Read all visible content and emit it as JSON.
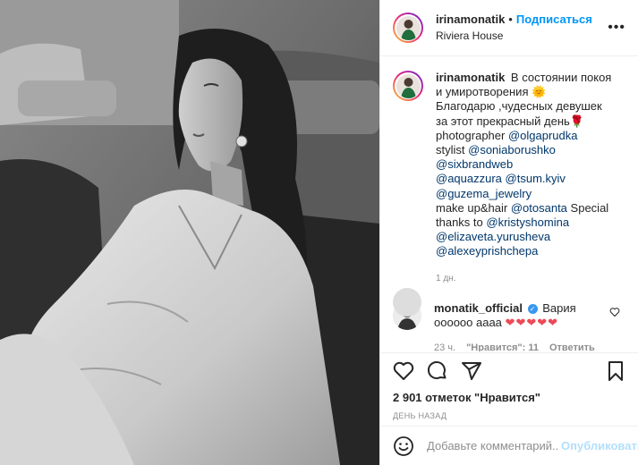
{
  "header": {
    "username": "irinamonatik",
    "separator": "•",
    "follow_label": "Подписаться",
    "location": "Riviera House",
    "more_icon": "more-options-icon"
  },
  "caption": {
    "username": "irinamonatik",
    "text_1": "В состоянии покоя и умиротворения",
    "sun_emoji": "🌞",
    "text_2": "Благодарю ,чудесных девушек за этот прекрасный день",
    "rose_emoji": "🌹",
    "photographer_label": "photographer",
    "photographer_tag": "@olgaprudka",
    "stylist_label": "stylist",
    "stylist_tag_1": "@soniaborushko",
    "stylist_tag_2": "@sixbrandweb",
    "tag_3": "@aquazzura",
    "tag_4": "@tsum.kyiv",
    "tag_5": "@guzema_jewelry",
    "makeup_label": "make up&hair",
    "makeup_tag": "@otosanta",
    "special_label": "Special thanks to",
    "thanks_tag_1": "@kristyshomina",
    "thanks_tag_2": "@elizaveta.yurusheva",
    "thanks_tag_3": "@alexeyprishchepa",
    "time": "1 дн."
  },
  "comment": {
    "username": "monatik_official",
    "verified_icon": "verified-badge-icon",
    "text": "Вария оооооо аaaa",
    "hearts": "❤❤❤❤❤",
    "time": "23 ч.",
    "likes_label": "\"Нравится\": 11",
    "reply_label": "Ответить"
  },
  "actions": {
    "likes_text": "2 901 отметок \"Нравится\"",
    "posted_ago": "ДЕНЬ НАЗАД"
  },
  "add_comment": {
    "placeholder": "Добавьте комментарий...",
    "publish_label": "Опубликовать"
  },
  "colors": {
    "accent": "#0095f6",
    "link": "#00376b",
    "heart": "#ed4956",
    "muted": "#8e8e8e",
    "publish_disabled": "#b2dffc"
  }
}
